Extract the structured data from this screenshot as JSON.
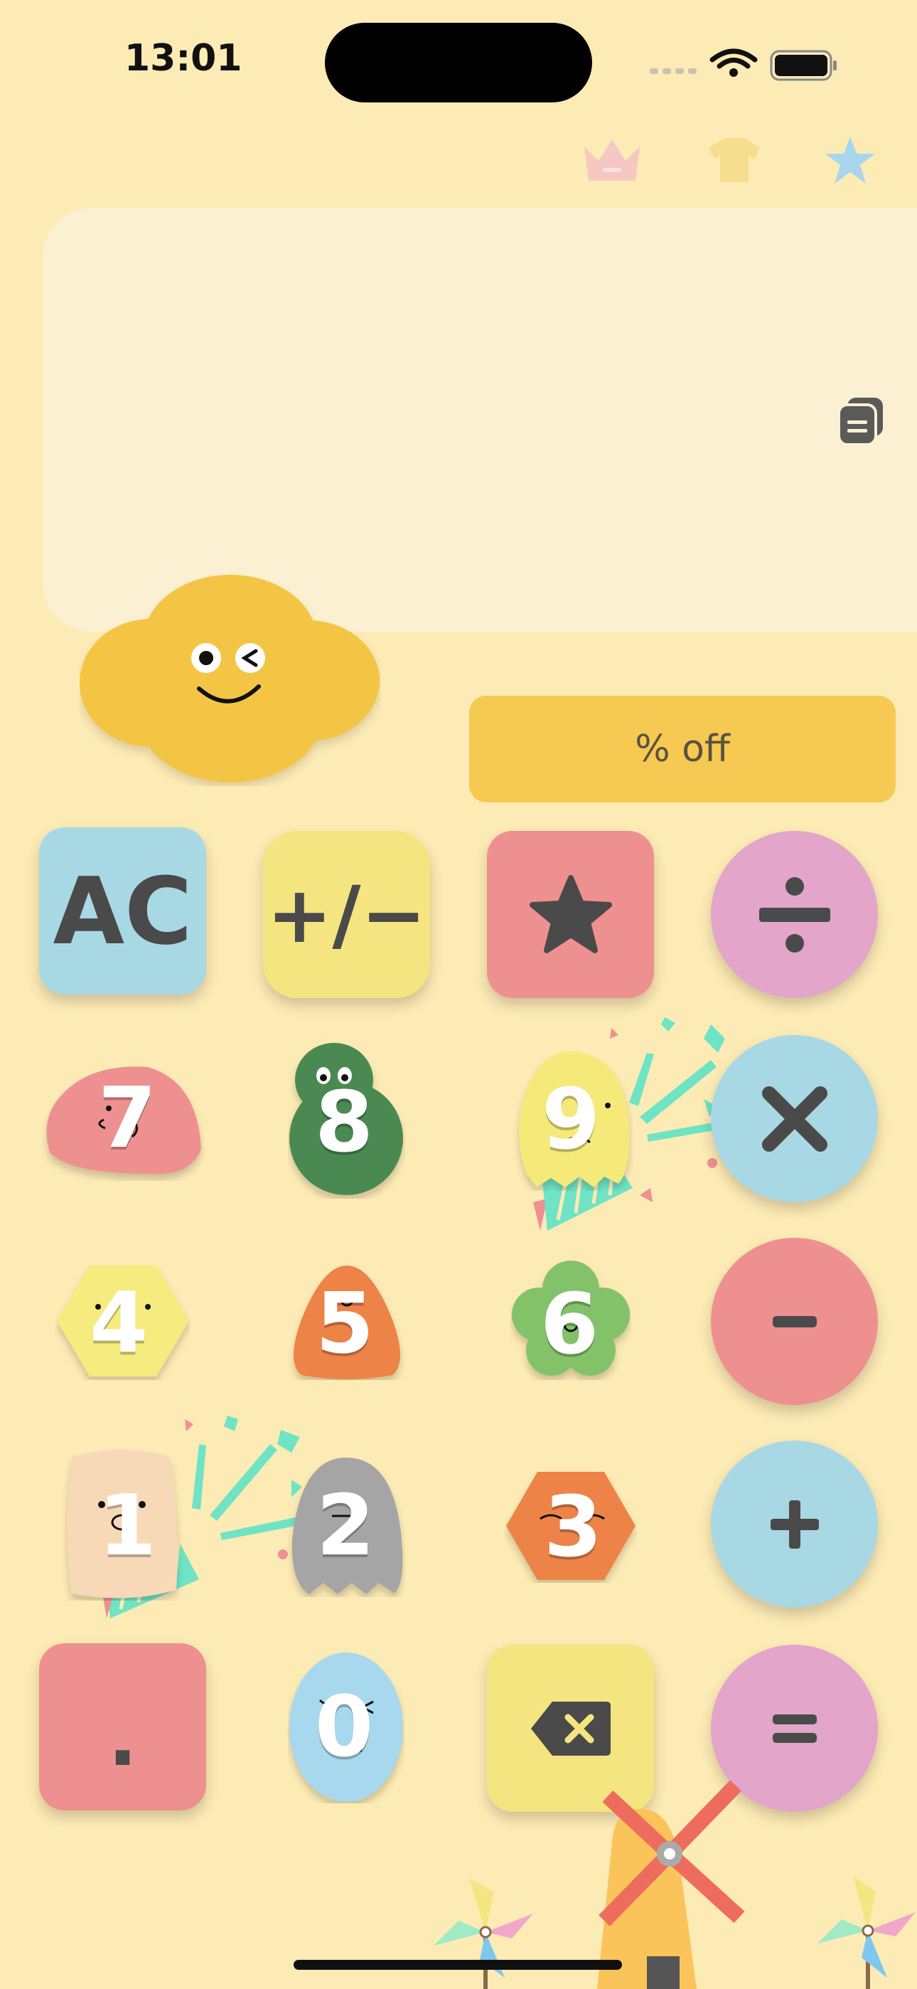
{
  "status": {
    "time": "13:01"
  },
  "discount_label": "% off",
  "keys": {
    "ac": "AC",
    "sign": "+/−",
    "dot": "."
  },
  "digits": {
    "d7": "7",
    "d8": "8",
    "d9": "9",
    "d4": "4",
    "d5": "5",
    "d6": "6",
    "d1": "1",
    "d2": "2",
    "d3": "3",
    "d0": "0"
  },
  "colors": {
    "background": "#FDEBB5",
    "display": "#FBF0D2",
    "discount": "#F6C952",
    "blue": "#A8D8E4",
    "yellow": "#F5E580",
    "pink": "#EF9090",
    "violet": "#E3A5C9"
  },
  "icons": [
    "crown-icon",
    "shirt-icon",
    "star-icon",
    "copy-icon",
    "divide-icon",
    "multiply-icon",
    "minus-icon",
    "plus-icon",
    "equals-icon",
    "backspace-icon"
  ]
}
